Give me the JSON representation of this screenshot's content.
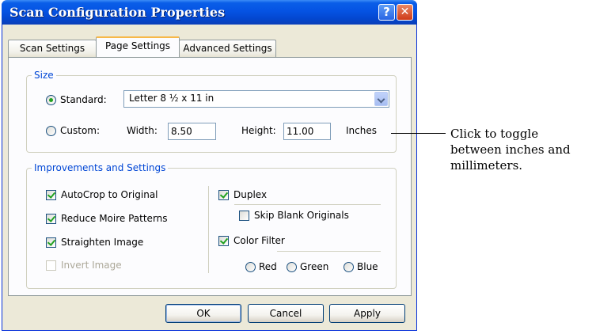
{
  "window": {
    "title": "Scan Configuration Properties",
    "help_glyph": "?",
    "close_glyph": "✕"
  },
  "tabs": [
    {
      "label": "Scan Settings",
      "active": false
    },
    {
      "label": "Page Settings",
      "active": true
    },
    {
      "label": "Advanced Settings",
      "active": false
    }
  ],
  "size_group": {
    "legend": "Size",
    "standard_label": "Standard:",
    "standard_selected": true,
    "standard_value": "Letter 8 ½ x 11 in",
    "custom_label": "Custom:",
    "width_label": "Width:",
    "width_value": "8.50",
    "height_label": "Height:",
    "height_value": "11.00",
    "units_label": "Inches"
  },
  "improvements_group": {
    "legend": "Improvements and Settings",
    "autocrop_label": "AutoCrop to Original",
    "moire_label": "Reduce Moire Patterns",
    "straighten_label": "Straighten Image",
    "invert_label": "Invert Image",
    "duplex_label": "Duplex",
    "skip_blank_label": "Skip Blank Originals",
    "color_filter_label": "Color Filter",
    "red_label": "Red",
    "green_label": "Green",
    "blue_label": "Blue"
  },
  "buttons": {
    "ok": "OK",
    "cancel": "Cancel",
    "apply": "Apply"
  },
  "callout": {
    "line1": "Click to toggle",
    "line2": "between inches and",
    "line3": "millimeters."
  },
  "colors": {
    "titlebar": "#0553e3",
    "group_legend": "#0046d5",
    "check_mark": "#21a121",
    "dialog_bg": "#ece9d8"
  }
}
